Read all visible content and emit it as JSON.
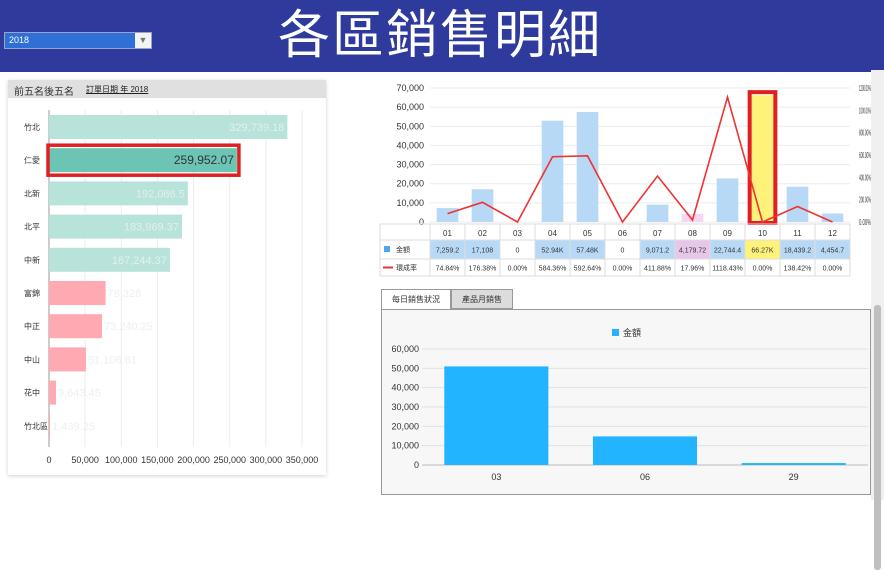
{
  "header": {
    "title": "各區銷售明細",
    "year_value": "2018",
    "year_arrow": "▼"
  },
  "left_panel": {
    "title": "前五名後五名",
    "subtitle": "訂單日期 年 2018"
  },
  "tabs": [
    {
      "label": "每日銷售狀況"
    },
    {
      "label": "產品月銷售"
    }
  ],
  "colors": {
    "top_bar": "#b8e3da",
    "top_bar_highlight": "#6cc4b4",
    "bottom_bar": "#ffa9b3",
    "highlight_box": "#e02020",
    "monthly_bar": "#b8d9f6",
    "line": "#ee3333",
    "daily_bar": "#23b4ff",
    "oct_fill": "#fff27a"
  },
  "chart_data": [
    {
      "type": "bar",
      "orientation": "horizontal",
      "categories": [
        "竹北",
        "仁愛",
        "北新",
        "北平",
        "中新",
        "富錦",
        "中正",
        "中山",
        "花中",
        "竹北區"
      ],
      "values": [
        329739.18,
        259952.07,
        192086.5,
        183969.37,
        167244.37,
        78328,
        73240.25,
        51106.61,
        9643.45,
        1439.25
      ],
      "data_labels": [
        "329,739.18",
        "259,952.07",
        "192,086.5",
        "183,969.37",
        "167,244.37",
        "78,328",
        "73,240.25",
        "51,106.61",
        "9,643.45",
        "1,439.25"
      ],
      "highlight": "仁愛",
      "xlim": [
        0,
        350000
      ],
      "x_ticks": [
        "0",
        "50,000",
        "100,000",
        "150,000",
        "200,000",
        "250,000",
        "300,000",
        "350,000"
      ],
      "grid": true
    },
    {
      "type": "bar+line",
      "categories": [
        "01",
        "02",
        "03",
        "04",
        "05",
        "06",
        "07",
        "08",
        "09",
        "10",
        "11",
        "12"
      ],
      "series": [
        {
          "name": "金額",
          "type": "bar",
          "values": [
            7259.2,
            17108,
            0,
            52940,
            57480,
            0,
            9071.2,
            4179.72,
            22744.4,
            66270,
            18439.2,
            4454.7
          ],
          "labels": [
            "7,259.2",
            "17,108",
            "0",
            "52.94K",
            "57.48K",
            "0",
            "9,071.2",
            "4,179.72",
            "22,744.4",
            "66.27K",
            "18,439.2",
            "4,454.7"
          ]
        },
        {
          "name": "環成率",
          "type": "line",
          "values": [
            74.84,
            176.38,
            0,
            584.36,
            592.64,
            0,
            411.88,
            17.96,
            1118.43,
            0,
            138.42,
            0
          ],
          "labels": [
            "74.84%",
            "176.38%",
            "0.00%",
            "584.36%",
            "592.64%",
            "0.00%",
            "411.88%",
            "17.96%",
            "1118.43%",
            "0.00%",
            "138.42%",
            "0.00%"
          ]
        }
      ],
      "highlight": "10",
      "y_ticks": [
        "0",
        "10,000",
        "20,000",
        "30,000",
        "40,000",
        "50,000",
        "60,000",
        "70,000"
      ],
      "y2_ticks": [
        "0.00%",
        "200.00%",
        "400.00%",
        "600.00%",
        "800.00%",
        "1000.00%",
        "1200.00%"
      ],
      "ylim": [
        0,
        70000
      ],
      "y2lim": [
        0,
        1200
      ],
      "grid": true
    },
    {
      "type": "bar",
      "categories": [
        "03",
        "06",
        "29"
      ],
      "series": [
        {
          "name": "金額",
          "values": [
            51000,
            14800,
            1000
          ]
        }
      ],
      "ylim": [
        0,
        60000
      ],
      "y_ticks": [
        "0",
        "10,000",
        "20,000",
        "30,000",
        "40,000",
        "50,000",
        "60,000"
      ],
      "legend": "top",
      "grid": true
    }
  ]
}
